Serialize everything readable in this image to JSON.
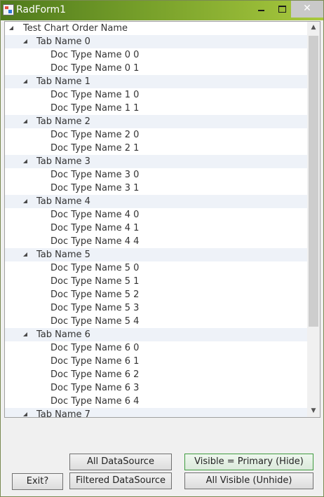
{
  "window": {
    "title": "RadForm1",
    "close_glyph": "✕"
  },
  "tree": {
    "root_label": "Test Chart Order Name",
    "rows": [
      {
        "label": "Test Chart Order Name",
        "level": 0,
        "expanded": true
      },
      {
        "label": "Tab Name 0",
        "level": 1,
        "expanded": true
      },
      {
        "label": "Doc Type Name 0 0",
        "level": 2
      },
      {
        "label": "Doc Type Name 0 1",
        "level": 2
      },
      {
        "label": "Tab Name 1",
        "level": 1,
        "expanded": true
      },
      {
        "label": "Doc Type Name 1 0",
        "level": 2
      },
      {
        "label": "Doc Type Name 1 1",
        "level": 2
      },
      {
        "label": "Tab Name 2",
        "level": 1,
        "expanded": true
      },
      {
        "label": "Doc Type Name 2 0",
        "level": 2
      },
      {
        "label": "Doc Type Name 2 1",
        "level": 2
      },
      {
        "label": "Tab Name 3",
        "level": 1,
        "expanded": true
      },
      {
        "label": "Doc Type Name 3 0",
        "level": 2
      },
      {
        "label": "Doc Type Name 3 1",
        "level": 2
      },
      {
        "label": "Tab Name 4",
        "level": 1,
        "expanded": true
      },
      {
        "label": "Doc Type Name 4 0",
        "level": 2
      },
      {
        "label": "Doc Type Name 4 1",
        "level": 2
      },
      {
        "label": "Doc Type Name 4 4",
        "level": 2
      },
      {
        "label": "Tab Name 5",
        "level": 1,
        "expanded": true
      },
      {
        "label": "Doc Type Name 5 0",
        "level": 2
      },
      {
        "label": "Doc Type Name 5 1",
        "level": 2
      },
      {
        "label": "Doc Type Name 5 2",
        "level": 2
      },
      {
        "label": "Doc Type Name 5 3",
        "level": 2
      },
      {
        "label": "Doc Type Name 5 4",
        "level": 2
      },
      {
        "label": "Tab Name 6",
        "level": 1,
        "expanded": true
      },
      {
        "label": "Doc Type Name 6 0",
        "level": 2
      },
      {
        "label": "Doc Type Name 6 1",
        "level": 2
      },
      {
        "label": "Doc Type Name 6 2",
        "level": 2
      },
      {
        "label": "Doc Type Name 6 3",
        "level": 2
      },
      {
        "label": "Doc Type Name 6 4",
        "level": 2
      },
      {
        "label": "Tab Name 7",
        "level": 1,
        "expanded": true
      }
    ]
  },
  "scrollbar": {
    "up_glyph": "▲",
    "down_glyph": "▼"
  },
  "buttons": {
    "exit": "Exit?",
    "all_datasource": "All DataSource",
    "filtered_datasource": "Filtered DataSource",
    "visible_primary": "Visible = Primary (Hide)",
    "all_visible": "All Visible (Unhide)"
  },
  "colors": {
    "titlebar_start": "#4f7a1c",
    "titlebar_end": "#a9c93e",
    "alt_row": "#eef2f8",
    "primary_button_border": "#3f9b3f"
  }
}
